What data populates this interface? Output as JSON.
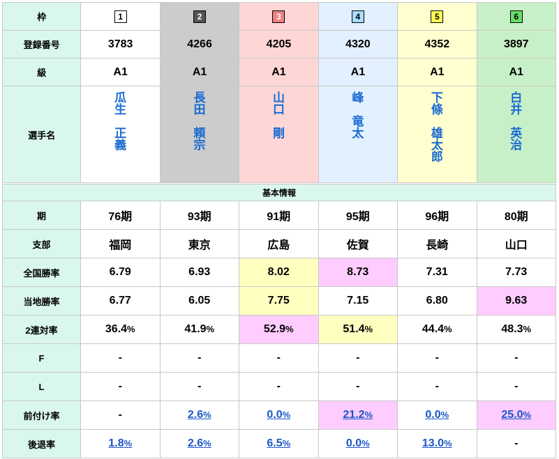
{
  "colors": {
    "label_bg": "#d9f7ee",
    "highlight_yellow": "#ffffc0",
    "highlight_pink": "#ffccff",
    "name_blue": "#1a6bd1",
    "link_blue": "#1a56c8"
  },
  "labels": {
    "waku": "枠",
    "reg_no": "登録番号",
    "grade": "級",
    "name": "選手名",
    "section": "基本情報",
    "term": "期",
    "branch": "支部",
    "national_win": "全国勝率",
    "local_win": "当地勝率",
    "top2": "2連対率",
    "f": "F",
    "l": "L",
    "zenzuke": "前付け率",
    "koutai": "後退率"
  },
  "racers": [
    {
      "waku": "1",
      "waku_bg": "#ffffff",
      "waku_fg": "#000000",
      "col_bg": "#ffffff",
      "reg": "3783",
      "grade": "A1",
      "family": "瓜生",
      "given": "正義",
      "term": "76期",
      "branch": "福岡",
      "national": "6.79",
      "local": "6.77",
      "top2": "36.4",
      "top2_unit": "%",
      "f": "-",
      "l": "-",
      "zen": "-",
      "zen_unit": "",
      "kou": "1.8",
      "kou_unit": "%"
    },
    {
      "waku": "2",
      "waku_bg": "#555555",
      "waku_fg": "#ffffff",
      "col_bg": "#cccccc",
      "reg": "4266",
      "grade": "A1",
      "family": "長田",
      "given": "頼宗",
      "term": "93期",
      "branch": "東京",
      "national": "6.93",
      "local": "6.05",
      "top2": "41.9",
      "top2_unit": "%",
      "f": "-",
      "l": "-",
      "zen": "2.6",
      "zen_unit": "%",
      "kou": "2.6",
      "kou_unit": "%"
    },
    {
      "waku": "3",
      "waku_bg": "#f08080",
      "waku_fg": "#ffffff",
      "col_bg": "#ffd6d6",
      "reg": "4205",
      "grade": "A1",
      "family": "山口",
      "given": "剛",
      "term": "91期",
      "branch": "広島",
      "national": "8.02",
      "local": "7.75",
      "top2": "52.9",
      "top2_unit": "%",
      "f": "-",
      "l": "-",
      "zen": "0.0",
      "zen_unit": "%",
      "kou": "6.5",
      "kou_unit": "%"
    },
    {
      "waku": "4",
      "waku_bg": "#a8dcff",
      "waku_fg": "#000000",
      "col_bg": "#e2f0ff",
      "reg": "4320",
      "grade": "A1",
      "family": "峰",
      "given": "竜太",
      "term": "95期",
      "branch": "佐賀",
      "national": "8.73",
      "local": "7.15",
      "top2": "51.4",
      "top2_unit": "%",
      "f": "-",
      "l": "-",
      "zen": "21.2",
      "zen_unit": "%",
      "kou": "0.0",
      "kou_unit": "%"
    },
    {
      "waku": "5",
      "waku_bg": "#ffff55",
      "waku_fg": "#000000",
      "col_bg": "#ffffd0",
      "reg": "4352",
      "grade": "A1",
      "family": "下條",
      "given": "雄太郎",
      "term": "96期",
      "branch": "長崎",
      "national": "7.31",
      "local": "6.80",
      "top2": "44.4",
      "top2_unit": "%",
      "f": "-",
      "l": "-",
      "zen": "0.0",
      "zen_unit": "%",
      "kou": "13.0",
      "kou_unit": "%"
    },
    {
      "waku": "6",
      "waku_bg": "#66dd66",
      "waku_fg": "#000000",
      "col_bg": "#c8f0c8",
      "reg": "3897",
      "grade": "A1",
      "family": "白井",
      "given": "英治",
      "term": "80期",
      "branch": "山口",
      "national": "7.73",
      "local": "9.63",
      "top2": "48.3",
      "top2_unit": "%",
      "f": "-",
      "l": "-",
      "zen": "25.0",
      "zen_unit": "%",
      "kou": "-",
      "kou_unit": ""
    }
  ],
  "highlights": {
    "national": {
      "2": "#ffffc0",
      "3": "#ffccff"
    },
    "local": {
      "2": "#ffffc0",
      "5": "#ffccff"
    },
    "top2": {
      "2": "#ffccff",
      "3": "#ffffc0"
    },
    "zen": {
      "3": "#ffccff",
      "5": "#ffccff"
    }
  },
  "links": {
    "zen": [
      1,
      2,
      3,
      4,
      5
    ],
    "kou": [
      0,
      1,
      2,
      3,
      4
    ]
  }
}
